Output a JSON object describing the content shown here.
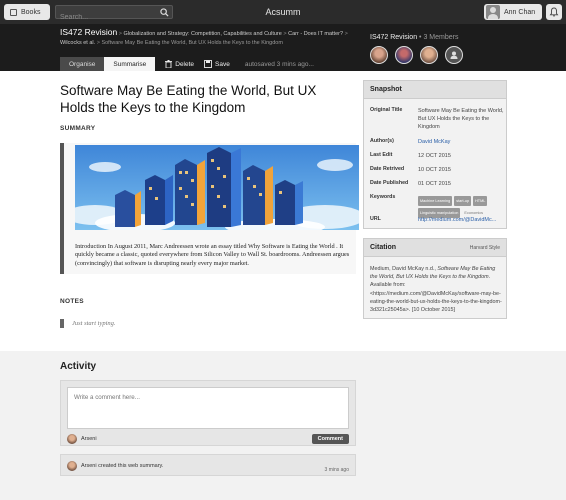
{
  "topbar": {
    "books_label": "Books",
    "search_placeholder": "Search...",
    "app_title": "Acsumm",
    "user_name": "Ann Chan"
  },
  "header": {
    "course": "IS472 Revision",
    "crumb_1": "Globalization and Strategy: Competition, Capabilities and Culture",
    "crumb_2": "Carr - Does IT matter?",
    "crumb_3": "Wilcocks et al.",
    "crumb_4": "Software May Be Eating the World, But UX Holds the Keys to the Kingdom",
    "group_name": "IS472 Revision",
    "member_count": "3 Members"
  },
  "toolbar": {
    "tab_organise": "Organise",
    "tab_summarise": "Summarise",
    "delete_label": "Delete",
    "save_label": "Save",
    "autosave": "autosaved 3 mins ago..."
  },
  "document": {
    "title": "Software May Be Eating the World, But UX Holds the Keys to the Kingdom",
    "summary_heading": "SUMMARY",
    "summary_text": "Introduction In August 2011, Marc Andreessen wrote an essay titled Why Software is Eating the World . It quickly became a classic, quoted everywhere from Silicon Valley to Wall St. boardrooms. Andreessen argues (convincingly) that software is disrupting nearly every major market.",
    "notes_heading": "NOTES",
    "notes_placeholder": "Just start typing."
  },
  "snapshot": {
    "heading": "Snapshot",
    "original_title_label": "Original Title",
    "original_title": "Software May Be Eating the World, But UX Holds the Keys to the Kingdom",
    "authors_label": "Author(s)",
    "authors": "David McKay",
    "last_edit_label": "Last Edit",
    "last_edit": "12 OCT 2015",
    "date_retrived_label": "Date Retrived",
    "date_retrived": "10 OCT 2015",
    "date_published_label": "Date Published",
    "date_published": "01 OCT 2015",
    "keywords_label": "Keywords",
    "keywords": [
      "Machine Learning",
      "start-up",
      "HTML",
      "Linguistic manipulation",
      "Economics"
    ],
    "url_label": "URL",
    "url": "http://medium.com/@DavidMc..."
  },
  "citation": {
    "heading": "Citation",
    "style": "Harvard Style",
    "text_pre": "Medium, David McKay n.d., ",
    "text_title": "Software May Be Eating the World, But UX Holds the Keys to the Kingdom",
    "text_post": ". Available from: <https://medium.com/@DavidMcKay/software-may-be-eating-the-world-but-ux-holds-the-keys-to-the-kingdom-3d321c25045a>. [10 October 2015]"
  },
  "activity": {
    "heading": "Activity",
    "comment_placeholder": "Write a comment here...",
    "commenter": "Arseni",
    "comment_button": "Comment",
    "item_text": "Arseni created this web summary.",
    "item_time": "3 mins ago"
  },
  "colors": {
    "topbar": "#2b2b2b",
    "header": "#1c1c1c",
    "link": "#2a5fa8"
  }
}
